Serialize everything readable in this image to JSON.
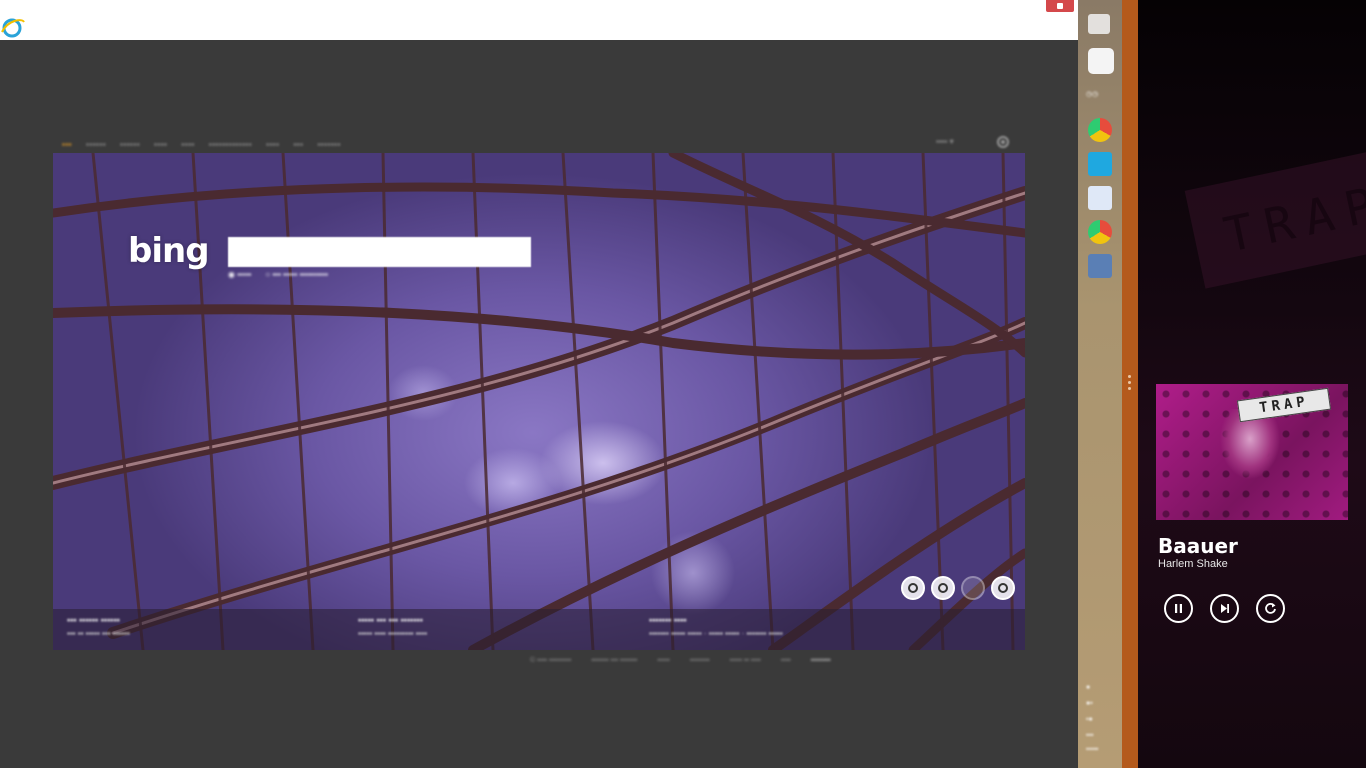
{
  "browser": {
    "brand": "bing",
    "search": {
      "value": "",
      "placeholder": ""
    }
  },
  "taskbar": {
    "icons": [
      "chrome-icon",
      "skype-icon",
      "folder-icon",
      "chrome-icon",
      "network-icon"
    ]
  },
  "music": {
    "artist": "Baauer",
    "track": "Harlem Shake",
    "album_art_text": "TRAP",
    "controls": [
      "pause",
      "next",
      "repeat"
    ]
  },
  "colors": {
    "splitter": "#b45a1c",
    "music_bg": "#1e0a17",
    "album_art": "#b01d8a"
  }
}
